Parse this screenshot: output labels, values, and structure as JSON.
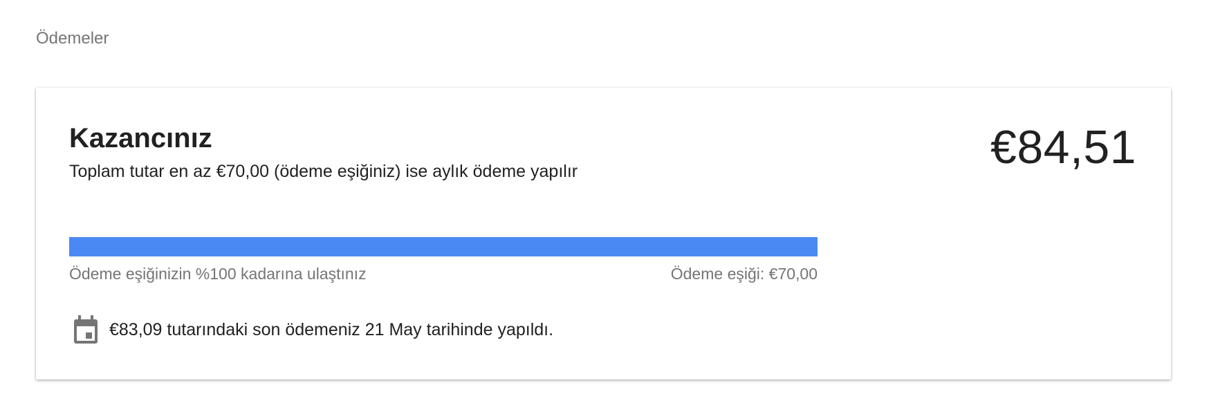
{
  "section": {
    "title": "Ödemeler"
  },
  "earnings_card": {
    "title": "Kazancınız",
    "subtitle": "Toplam tutar en az €70,00 (ödeme eşiğiniz) ise aylık ödeme yapılır",
    "balance": "€84,51",
    "progress": {
      "percent": 100,
      "left_label": "Ödeme eşiğinizin %100 kadarına ulaştınız",
      "right_label": "Ödeme eşiği: €70,00",
      "fill_color": "#4a89f3"
    },
    "last_payment": {
      "icon": "calendar-icon",
      "text": "€83,09 tutarındaki son ödemeniz 21 May tarihinde yapıldı."
    }
  }
}
